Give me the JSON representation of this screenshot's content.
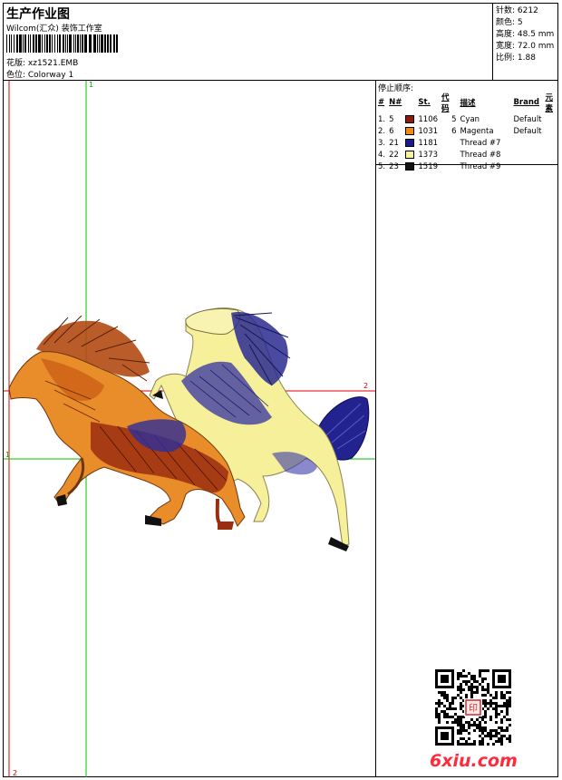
{
  "header": {
    "title": "生产作业图",
    "company": "Wilcom(汇众) 装饰工作室",
    "design_label": "花版: xz1521.EMB",
    "colorway_label": "色位:  Colorway 1"
  },
  "stats": {
    "stitches": "针数: 6212",
    "colors": "颜色: 5",
    "height": "高度: 48.5 mm",
    "width": "宽度: 72.0 mm",
    "scale": "比例: 1.88"
  },
  "stop_sequence": {
    "title": "停止顺序:",
    "columns": [
      "#",
      "N#",
      "St.",
      "代码",
      "描述",
      "Brand",
      "元素"
    ],
    "rows": [
      {
        "idx": "1.",
        "n": "5",
        "color": "#8b1a10",
        "st": "1106",
        "code": "5",
        "desc": "Cyan",
        "brand": "Default"
      },
      {
        "idx": "2.",
        "n": "6",
        "color": "#f08a10",
        "st": "1031",
        "code": "6",
        "desc": "Magenta",
        "brand": "Default"
      },
      {
        "idx": "3.",
        "n": "21",
        "color": "#1a1a8c",
        "st": "1181",
        "code": "",
        "desc": "Thread #7",
        "brand": ""
      },
      {
        "idx": "4.",
        "n": "22",
        "color": "#f8f29a",
        "st": "1373",
        "code": "",
        "desc": "Thread #8",
        "brand": ""
      },
      {
        "idx": "5.",
        "n": "23",
        "color": "#111111",
        "st": "1519",
        "code": "",
        "desc": "Thread #9",
        "brand": ""
      }
    ]
  },
  "guides": {
    "v1": "1",
    "v2": "2",
    "h1": "1",
    "h2": "2"
  },
  "colors": {
    "guide_red": "#e00000",
    "guide_green": "#00c000",
    "watermark": "#ff2a3c"
  },
  "watermark": "6xiu.com"
}
